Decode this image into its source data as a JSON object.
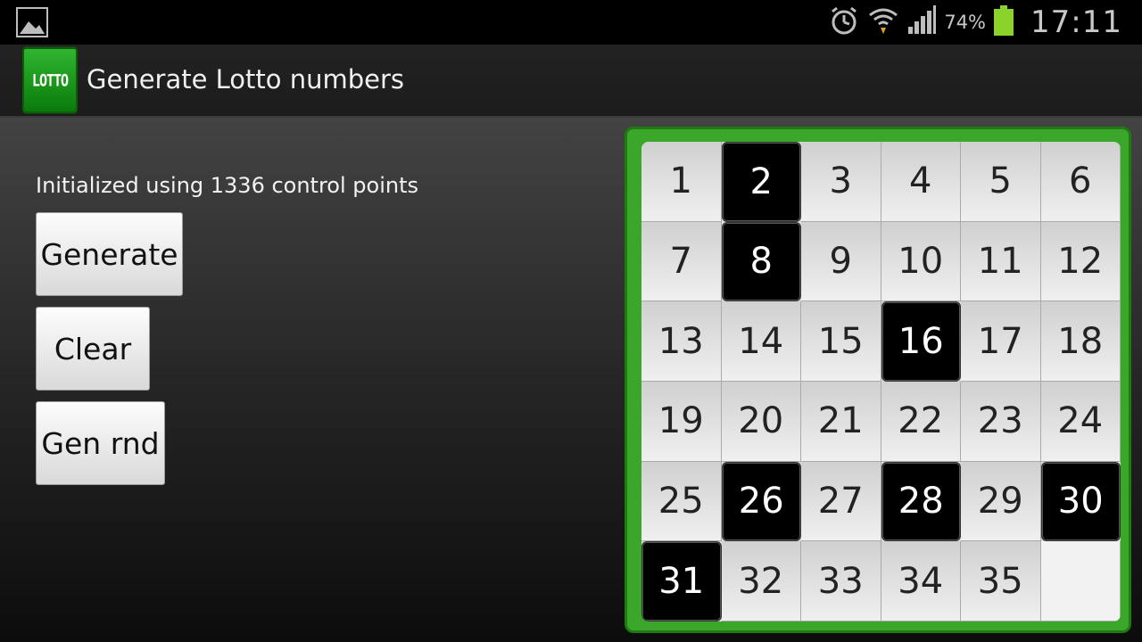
{
  "statusbar": {
    "battery_percent": "74%",
    "time": "17:11",
    "icons": [
      "image-icon",
      "alarm-icon",
      "wifi-icon",
      "signal-icon",
      "battery-icon"
    ]
  },
  "actionbar": {
    "logo_text": "LOTTO",
    "title": "Generate Lotto numbers"
  },
  "main": {
    "status_text": "Initialized using 1336 control points",
    "buttons": {
      "generate": "Generate",
      "clear": "Clear",
      "gen_rnd": "Gen rnd"
    }
  },
  "grid": {
    "numbers": [
      1,
      2,
      3,
      4,
      5,
      6,
      7,
      8,
      9,
      10,
      11,
      12,
      13,
      14,
      15,
      16,
      17,
      18,
      19,
      20,
      21,
      22,
      23,
      24,
      25,
      26,
      27,
      28,
      29,
      30,
      31,
      32,
      33,
      34,
      35
    ],
    "selected": [
      2,
      8,
      16,
      26,
      28,
      30,
      31
    ]
  },
  "colors": {
    "frame_green": "#3aa72a",
    "selected_bg": "#000000",
    "cell_bg": "#e0e0e0"
  }
}
